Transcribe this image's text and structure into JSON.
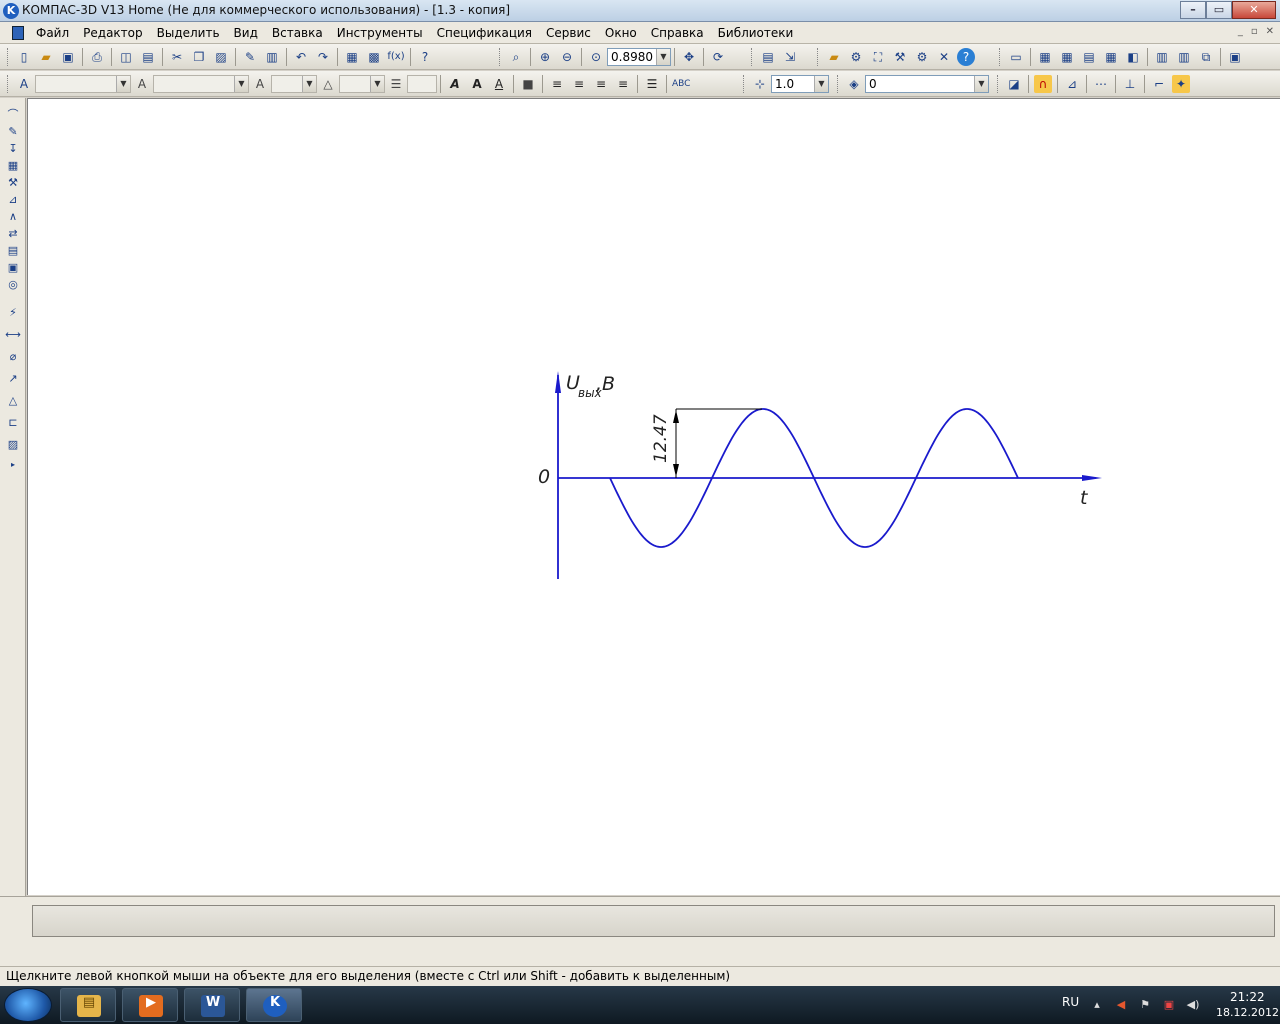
{
  "window": {
    "title": "КОМПАС-3D V13 Home (Не для коммерческого использования) - [1.3 - копия]",
    "app_icon": "kompas-logo-icon"
  },
  "menu": {
    "items": [
      "Файл",
      "Редактор",
      "Выделить",
      "Вид",
      "Вставка",
      "Инструменты",
      "Спецификация",
      "Сервис",
      "Окно",
      "Справка",
      "Библиотеки"
    ]
  },
  "toolbar": {
    "zoom_value": "0.8980",
    "line_scale_value": "1.0",
    "layer_value": "0"
  },
  "drawing": {
    "origin_label": "0",
    "y_axis_label_main": "U",
    "y_axis_label_sub": "вых",
    "y_axis_label_unit": ",B",
    "x_axis_label": "t",
    "dimension_value": "12.47",
    "curve_color": "#1a1acc"
  },
  "statusbar": {
    "hint": "Щелкните левой кнопкой мыши на объекте для его выделения (вместе с Ctrl или Shift - добавить к выделенным)"
  },
  "taskbar": {
    "apps": [
      "file-explorer-icon",
      "media-player-icon",
      "word-icon",
      "kompas-icon"
    ],
    "tray": {
      "language": "RU",
      "time": "21:22",
      "date": "18.12.2012"
    }
  }
}
